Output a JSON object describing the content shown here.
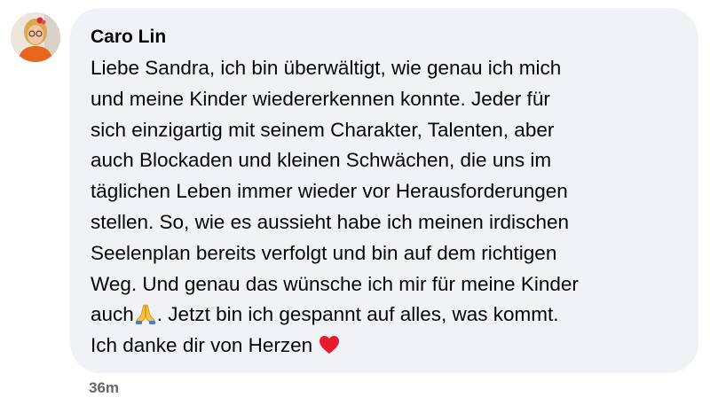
{
  "comment": {
    "author": "Caro Lin",
    "avatar_icon": "profile-photo-avatar",
    "lines": [
      "Liebe Sandra, ich bin überwältigt, wie genau ich mich",
      "und meine Kinder wiedererkennen konnte. Jeder für",
      "sich einzigartig mit seinem Charakter, Talenten, aber",
      "auch Blockaden und kleinen Schwächen, die uns im",
      "täglichen Leben immer wieder vor Herausforderungen",
      "stellen. So, wie es aussieht habe ich meinen irdischen",
      "Seelenplan bereits verfolgt und bin auf dem richtigen",
      "Weg. Und genau das wünsche ich mir für meine Kinder"
    ],
    "line9_before": "auch",
    "line9_emoji": "folded-hands-emoji",
    "line9_after": ". Jetzt bin ich gespannt auf alles, was kommt.",
    "line10_before": "Ich danke dir von Herzen ",
    "line10_emoji": "red-heart-emoji",
    "timestamp": "36m"
  },
  "colors": {
    "bubble_background": "#f0f2f5",
    "text": "#050505",
    "timestamp": "#65676b",
    "heart": "#e8192c",
    "hands": "#f7c23a"
  }
}
